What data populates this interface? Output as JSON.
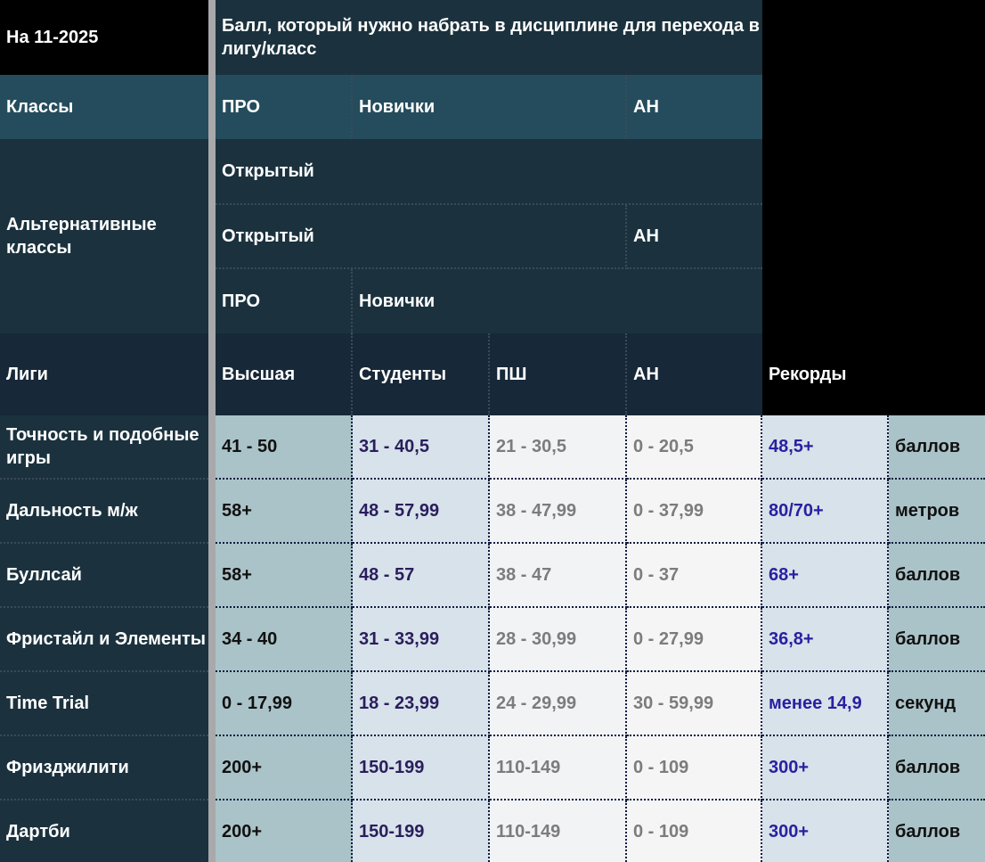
{
  "header": {
    "date_label": "На 11-2025",
    "threshold_title": "Балл, который нужно набрать в дисциплине для перехода в лигу/класс"
  },
  "classes": {
    "label": "Классы",
    "pro": "ПРО",
    "novice": "Новички",
    "an": "АН"
  },
  "alt_classes": {
    "label": "Альтернативные классы",
    "row1": "Открытый",
    "row2_open": "Открытый",
    "row2_an": "АН",
    "row3_pro": "ПРО",
    "row3_novice": "Новички"
  },
  "leagues": {
    "label": "Лиги",
    "top": "Высшая",
    "students": "Студенты",
    "psh": "ПШ",
    "an": "АН",
    "records": "Рекорды"
  },
  "rows": [
    {
      "name": "Точность и подобные игры",
      "top": "41 - 50",
      "students": "31 - 40,5",
      "psh": "21 - 30,5",
      "an": "0 - 20,5",
      "record": "48,5+",
      "unit": "баллов"
    },
    {
      "name": "Дальность м/ж",
      "top": "58+",
      "students": "48 - 57,99",
      "psh": "38 - 47,99",
      "an": "0 - 37,99",
      "record": "80/70+",
      "unit": "метров"
    },
    {
      "name": "Буллсай",
      "top": "58+",
      "students": "48 - 57",
      "psh": "38 - 47",
      "an": "0 - 37",
      "record": "68+",
      "unit": "баллов"
    },
    {
      "name": "Фристайл и Элементы",
      "top": "34 - 40",
      "students": "31 - 33,99",
      "psh": "28 - 30,99",
      "an": "0 - 27,99",
      "record": "36,8+",
      "unit": "баллов"
    },
    {
      "name": "Time Trial",
      "top": "0 - 17,99",
      "students": "18 - 23,99",
      "psh": "24 - 29,99",
      "an": "30 - 59,99",
      "record": "менее 14,9",
      "unit": "секунд"
    },
    {
      "name": "Фризджилити",
      "top": "200+",
      "students": "150-199",
      "psh": "110-149",
      "an": "0 - 109",
      "record": "300+",
      "unit": "баллов"
    },
    {
      "name": "Дартби",
      "top": "200+",
      "students": "150-199",
      "psh": "110-149",
      "an": "0 - 109",
      "record": "300+",
      "unit": "баллов"
    }
  ]
}
